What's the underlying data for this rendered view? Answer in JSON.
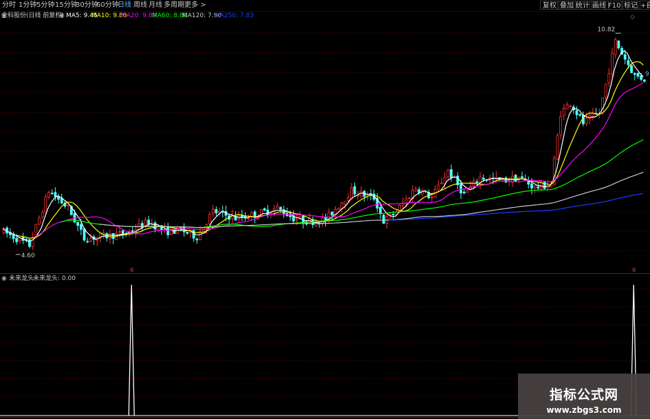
{
  "toolbar": {
    "periods": [
      {
        "label": "分时"
      },
      {
        "label": "1分钟"
      },
      {
        "label": "5分钟"
      },
      {
        "label": "15分钟"
      },
      {
        "label": "30分钟"
      },
      {
        "label": "60分钟"
      },
      {
        "label": "日线",
        "active": true
      },
      {
        "label": "周线"
      },
      {
        "label": "月线"
      },
      {
        "label": "多周期"
      },
      {
        "label": "更多 >"
      }
    ],
    "right_buttons": [
      {
        "label": "复权"
      },
      {
        "label": "叠加"
      },
      {
        "label": "统计"
      },
      {
        "label": "画线"
      },
      {
        "label": "F10"
      },
      {
        "label": "标记"
      },
      {
        "label": "+自"
      }
    ]
  },
  "main_legend": {
    "title": "全科股份(日线 前复权)",
    "items": [
      {
        "label": "MA5: 9.45",
        "color": "#ffffff"
      },
      {
        "label": "MA10: 9.80",
        "color": "#ffff00"
      },
      {
        "label": "MA20: 9.89",
        "color": "#ff00ff"
      },
      {
        "label": "MA60: 8.80",
        "color": "#00ff00"
      },
      {
        "label": "MA120: 7.90",
        "color": "#c8c8c8"
      },
      {
        "label": "MA250: 7.83",
        "color": "#1e3cff"
      }
    ]
  },
  "price_labels": {
    "high": "10.82",
    "low": "4.60",
    "right_edge": "9"
  },
  "signal_markers": [
    {
      "label": "6",
      "day": 40
    },
    {
      "label": "6",
      "day": 196
    }
  ],
  "indicator_legend": {
    "name": "未来龙头",
    "value_label": "未来龙头: 0.00"
  },
  "watermark": {
    "title": "指标公式网",
    "url": "www.zbgs3.com"
  },
  "colors": {
    "up": "#ff3232",
    "down": "#54ffff",
    "grid": "#5a0000"
  }
}
